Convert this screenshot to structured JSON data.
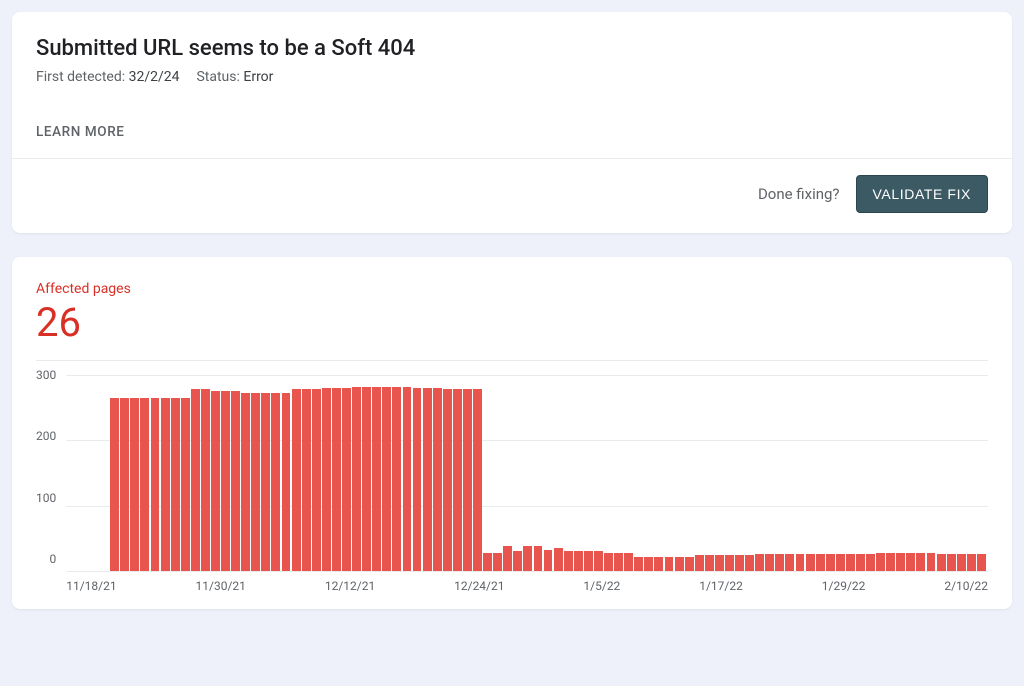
{
  "header": {
    "title": "Submitted URL seems to be a Soft 404",
    "first_detected_label": "First detected:",
    "first_detected_value": "32/2/24",
    "status_label": "Status:",
    "status_value": "Error",
    "learn_more": "LEARN MORE",
    "done_fixing": "Done fixing?",
    "validate_fix": "VALIDATE FIX"
  },
  "affected": {
    "label": "Affected pages",
    "value": "26"
  },
  "chart_data": {
    "type": "bar",
    "title": "",
    "xlabel": "",
    "ylabel": "",
    "ylim": [
      0,
      300
    ],
    "color": "#e8554e",
    "x_ticks": [
      "11/18/21",
      "11/30/21",
      "12/12/21",
      "12/24/21",
      "1/5/22",
      "1/17/22",
      "1/29/22",
      "2/10/22"
    ],
    "y_ticks": [
      300,
      200,
      100,
      0
    ],
    "values": [
      265,
      265,
      265,
      265,
      265,
      265,
      265,
      265,
      278,
      278,
      275,
      275,
      275,
      272,
      272,
      272,
      272,
      272,
      278,
      278,
      278,
      280,
      280,
      280,
      282,
      282,
      282,
      282,
      282,
      282,
      280,
      280,
      280,
      278,
      278,
      278,
      278,
      28,
      28,
      38,
      30,
      38,
      38,
      32,
      35,
      30,
      30,
      30,
      30,
      28,
      28,
      28,
      22,
      22,
      22,
      22,
      22,
      22,
      24,
      24,
      24,
      24,
      24,
      24,
      26,
      26,
      26,
      26,
      26,
      26,
      26,
      26,
      26,
      26,
      26,
      26,
      28,
      28,
      28,
      28,
      28,
      28,
      26,
      26,
      26,
      26,
      26
    ]
  }
}
